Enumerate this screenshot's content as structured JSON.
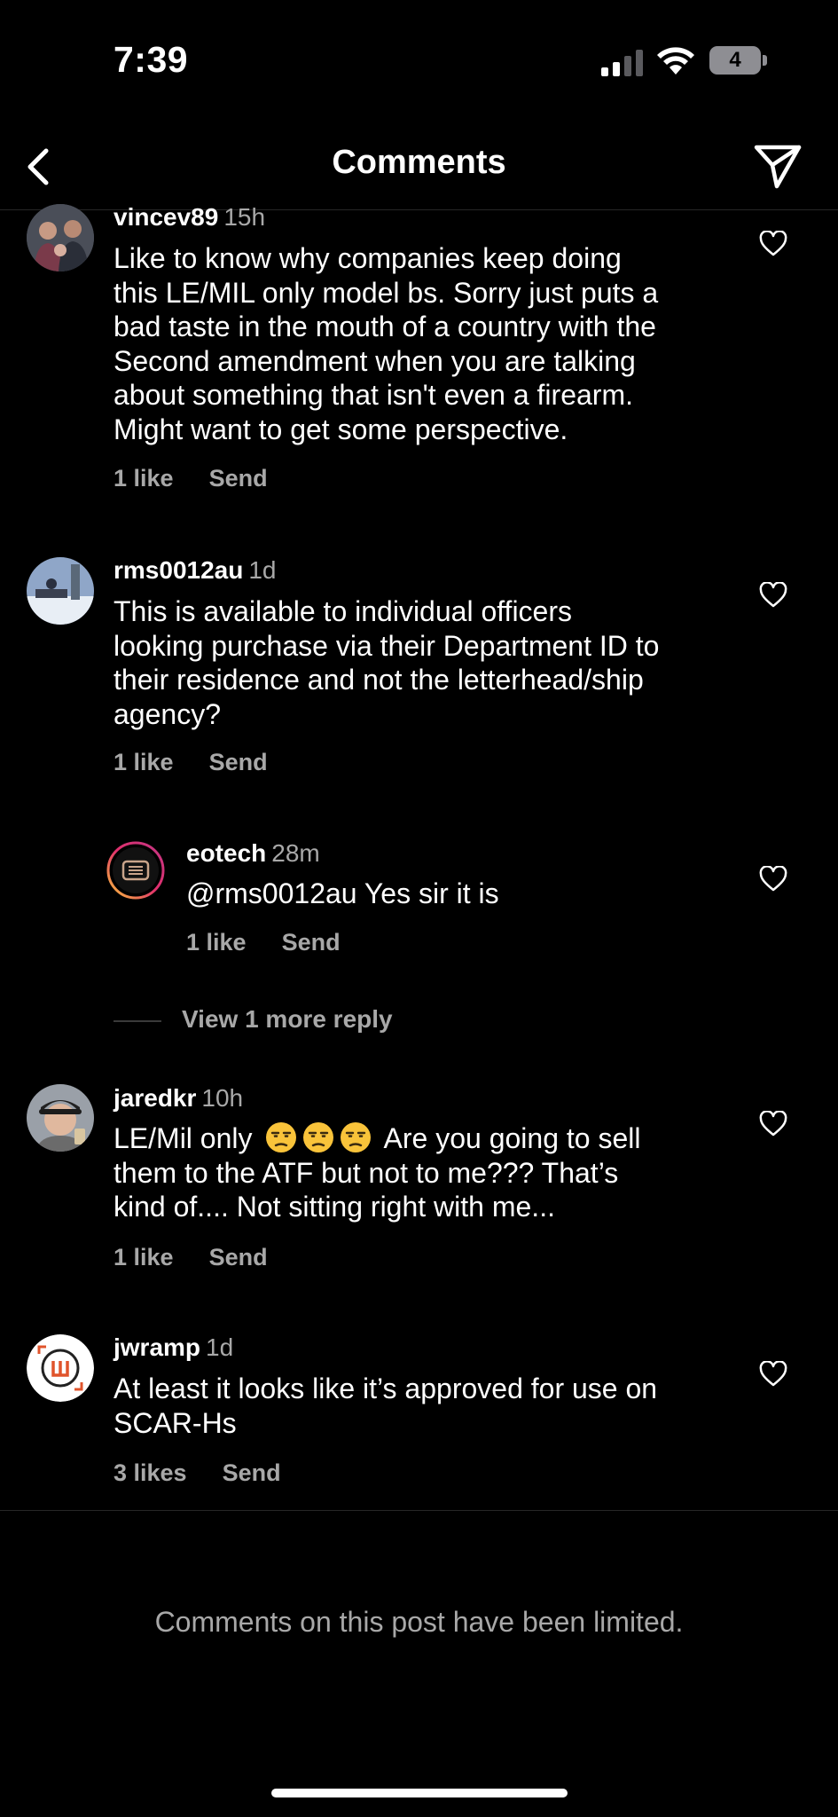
{
  "status_bar": {
    "time": "7:39",
    "battery": "4"
  },
  "nav": {
    "title": "Comments"
  },
  "comments": [
    {
      "username": "vincev89",
      "timestamp": "15h",
      "text_lines": [
        "Like to know why companies keep doing",
        "this LE/MIL only model bs. Sorry just puts a",
        "bad taste in the mouth of a country with the",
        "Second amendment when you are talking",
        "about something that isn't even a firearm.",
        "Might want to get some perspective."
      ],
      "likes": "1 like",
      "send": "Send"
    },
    {
      "username": "rms0012au",
      "timestamp": "1d",
      "text_lines": [
        "This is available to individual officers",
        "looking purchase via their Department ID to",
        "their residence and not the letterhead/ship",
        "agency?"
      ],
      "likes": "1 like",
      "send": "Send"
    },
    {
      "username": "eotech",
      "timestamp": "28m",
      "text_lines": [
        "@rms0012au Yes sir it is"
      ],
      "likes": "1 like",
      "send": "Send"
    },
    {
      "username": "jaredkr",
      "timestamp": "10h",
      "text_lines_first_prefix": "LE/Mil only",
      "text_lines_first_suffix": "Are you going to sell",
      "text_lines": [
        "them to the ATF but not to me??? That’s",
        "kind of.... Not sitting right with me..."
      ],
      "likes": "1 like",
      "send": "Send"
    },
    {
      "username": "jwramp",
      "timestamp": "1d",
      "text_lines": [
        "At least it looks like it’s approved for use on",
        "SCAR-Hs"
      ],
      "likes": "3 likes",
      "send": "Send"
    }
  ],
  "view_more_replies": "View 1 more reply",
  "footer": {
    "limited_notice": "Comments on this post have been limited."
  },
  "icons": {
    "back": "chevron-left-icon",
    "send": "paper-plane-icon",
    "like": "heart-icon",
    "emoji": "unamused-face-emoji"
  },
  "colors": {
    "background": "#000000",
    "text": "#ffffff",
    "secondary": "#a8a8a8"
  }
}
